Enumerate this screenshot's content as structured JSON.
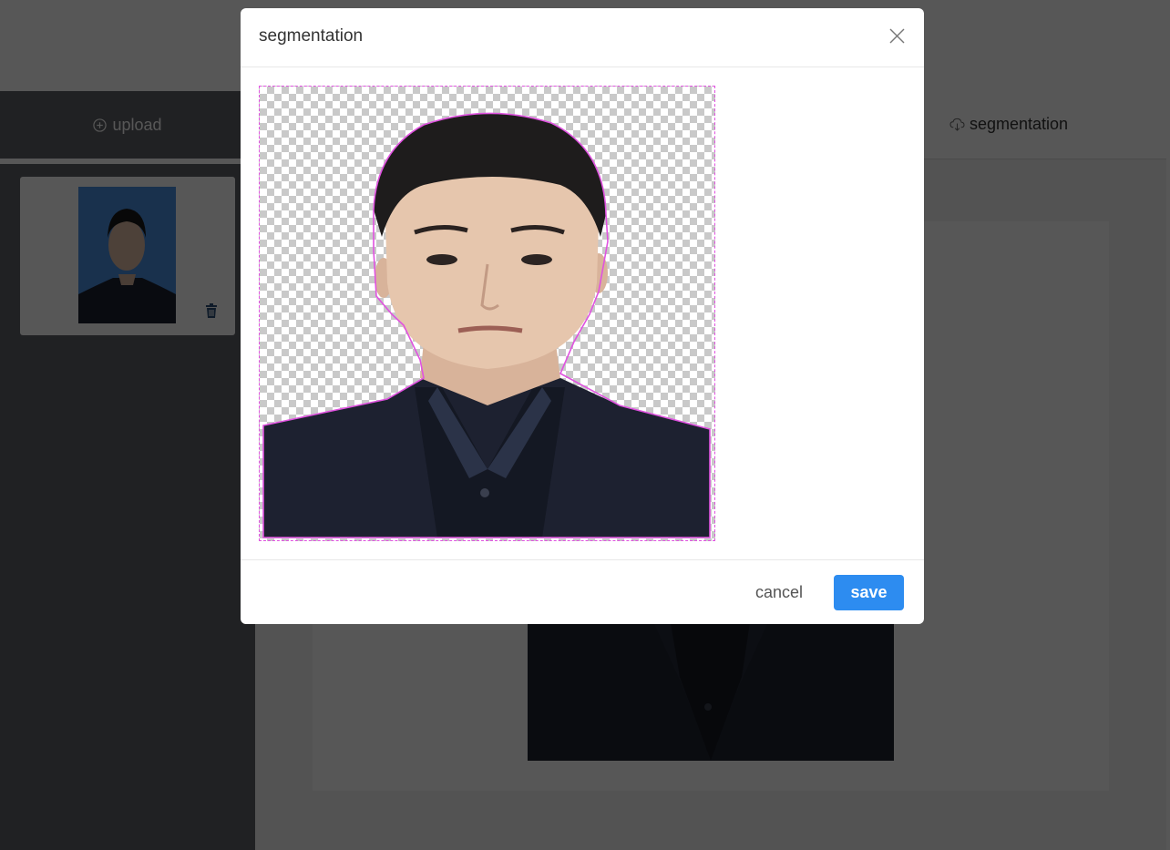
{
  "sidebar": {
    "upload_label": "upload"
  },
  "main": {
    "header": {
      "segmentation_label": "segmentation"
    }
  },
  "modal": {
    "title": "segmentation",
    "cancel_label": "cancel",
    "save_label": "save"
  },
  "colors": {
    "primary": "#2d8cf0",
    "photo_background": "#4b8fe0",
    "mask_outline": "#e052e0",
    "sidebar_bg": "#2e3035"
  },
  "icons": {
    "upload": "plus-circle-icon",
    "delete": "trash-icon",
    "segmentation": "cloud-download-icon",
    "close": "close-icon"
  }
}
